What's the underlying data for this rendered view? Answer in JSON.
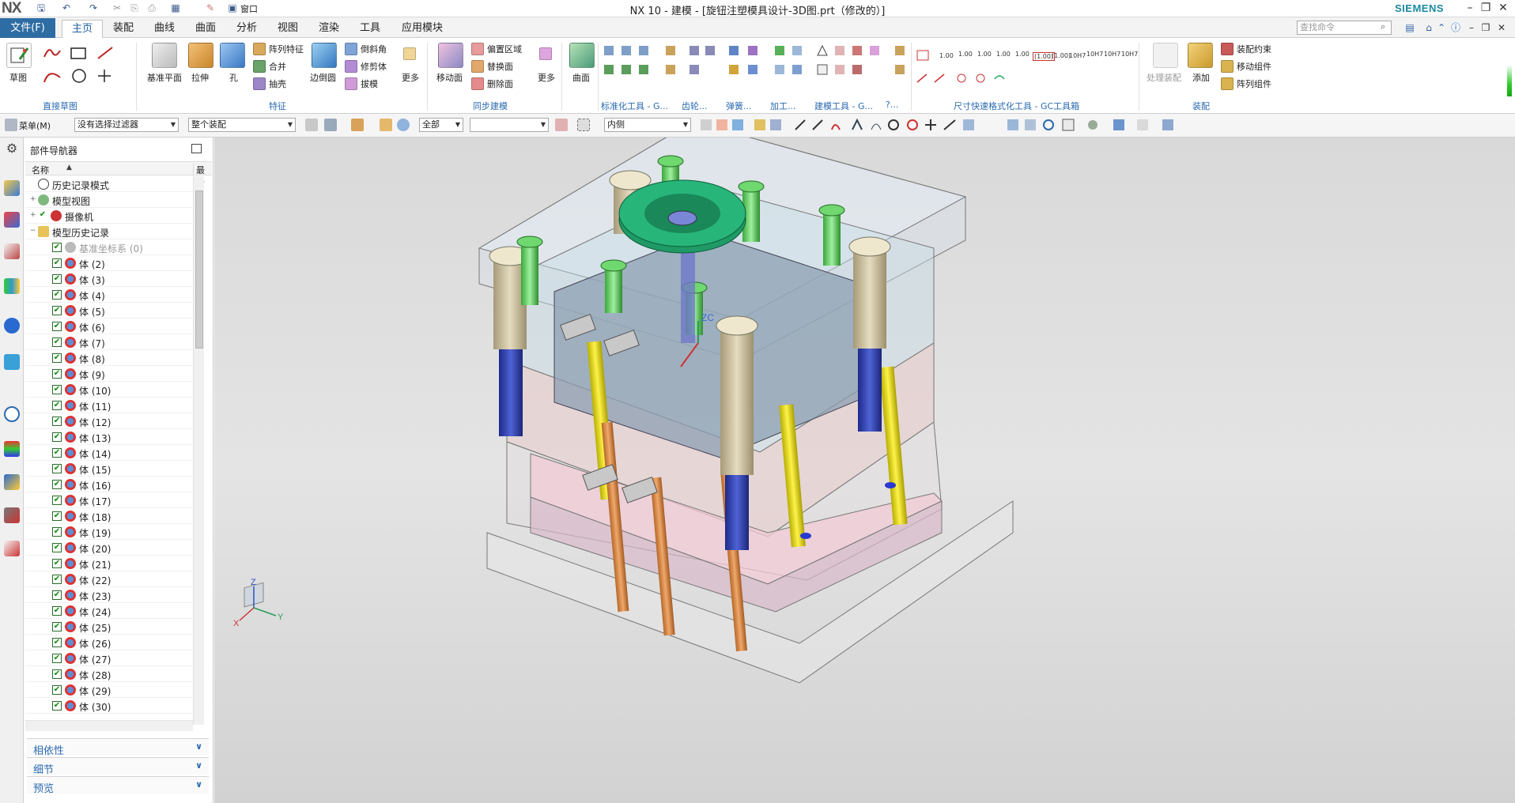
{
  "title_bar": {
    "logo": "NX",
    "window_title": "NX 10 - 建模 - [旋钮注塑模具设计-3D图.prt（修改的）]",
    "brand": "SIEMENS",
    "window_menu_label": "窗口",
    "controls": [
      "minimize",
      "restore",
      "close"
    ]
  },
  "tabs": {
    "file_label": "文件(F)",
    "items": [
      "主页",
      "装配",
      "曲线",
      "曲面",
      "分析",
      "视图",
      "渲染",
      "工具",
      "应用模块"
    ],
    "active": "主页"
  },
  "command_search": {
    "placeholder": "查找命令"
  },
  "ribbon": {
    "direct_sketch": {
      "group_label": "直接草图",
      "sketch_label": "草图"
    },
    "feature": {
      "group_label": "特征",
      "datum_plane": "基准平面",
      "extrude": "拉伸",
      "hole": "孔",
      "pattern_feature": "阵列特征",
      "unite": "合并",
      "shell": "抽壳",
      "edge_blend": "边倒圆",
      "chamfer": "倒斜角",
      "trim_body": "修剪体",
      "draft": "拔模",
      "more": "更多"
    },
    "sync": {
      "group_label": "同步建模",
      "move_face": "移动面",
      "offset_region": "偏置区域",
      "replace_face": "替换面",
      "delete_face": "删除面",
      "more": "更多"
    },
    "surface": {
      "label": "曲面"
    },
    "gc_groups": [
      "标准化工具 - G...",
      "齿轮...",
      "弹簧...",
      "加工...",
      "建模工具 - G...",
      "?..."
    ],
    "dimension_group_label": "尺寸快速格式化工具 - GC工具箱",
    "dimension_values": [
      "1.00",
      "1.00",
      "1.00",
      "1.00",
      "1.00",
      "(1.00)",
      "(1.00)",
      "10H7",
      "10H7",
      "10H7",
      "10H7"
    ],
    "assembly": {
      "group_label": "装配",
      "process_assembly": "处理装配",
      "add": "添加",
      "constraint": "装配约束",
      "move_component": "移动组件",
      "pattern_component": "阵列组件"
    }
  },
  "selection_bar": {
    "menu_label": "菜单(M)",
    "filter": "没有选择过滤器",
    "scope": "整个装配",
    "all": "全部",
    "blank": "",
    "inside": "内侧"
  },
  "navigator": {
    "title": "部件导航器",
    "col_name": "名称",
    "col_recent": "最新",
    "top_rows": [
      {
        "label": "历史记录模式",
        "kind": "history"
      },
      {
        "label": "模型视图",
        "kind": "views"
      },
      {
        "label": "摄像机",
        "kind": "camera"
      },
      {
        "label": "模型历史记录",
        "kind": "folder"
      }
    ],
    "datum_row": "基准坐标系 (0)",
    "bodies": [
      "体 (2)",
      "体 (3)",
      "体 (4)",
      "体 (5)",
      "体 (6)",
      "体 (7)",
      "体 (8)",
      "体 (9)",
      "体 (10)",
      "体 (11)",
      "体 (12)",
      "体 (13)",
      "体 (14)",
      "体 (15)",
      "体 (16)",
      "体 (17)",
      "体 (18)",
      "体 (19)",
      "体 (20)",
      "体 (21)",
      "体 (22)",
      "体 (23)",
      "体 (24)",
      "体 (25)",
      "体 (26)",
      "体 (27)",
      "体 (28)",
      "体 (29)",
      "体 (30)"
    ],
    "panels": [
      "相依性",
      "细节",
      "预览"
    ]
  },
  "viewport": {
    "triad": {
      "x": "X",
      "y": "Y",
      "z": "Z"
    },
    "wcs_label": "ZC"
  }
}
